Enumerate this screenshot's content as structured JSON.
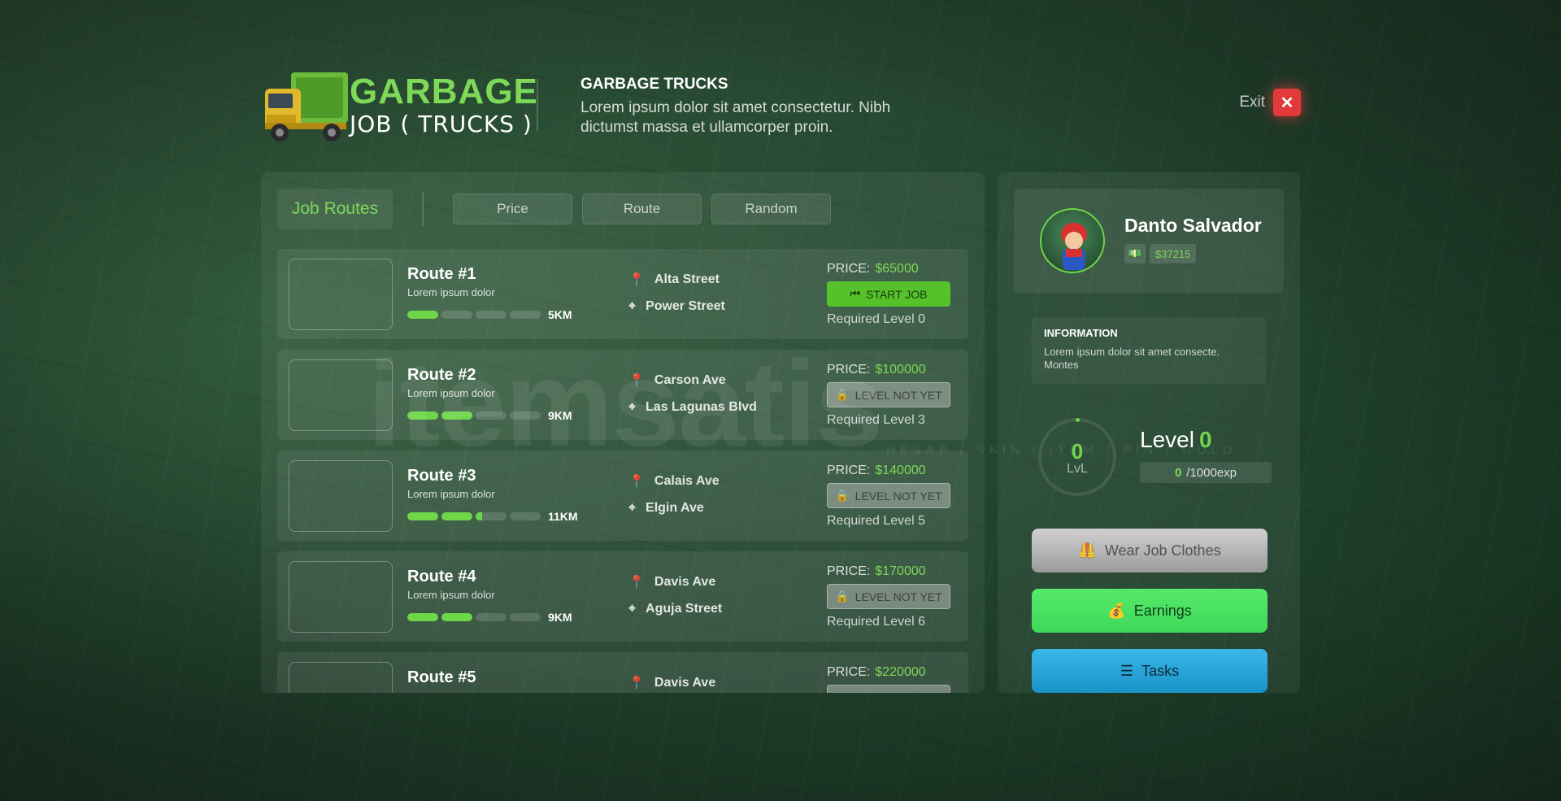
{
  "header": {
    "logo_line1": "GARBAGE",
    "logo_line2": "JOB ( TRUCKS )",
    "info_title": "GARBAGE TRUCKS",
    "info_desc": "Lorem ipsum dolor sit amet consectetur. Nibh dictumst massa et ullamcorper proin.",
    "exit_label": "Exit",
    "exit_icon": "close-icon"
  },
  "tabs": {
    "active": "Job Routes",
    "filters": [
      "Price",
      "Route",
      "Random"
    ]
  },
  "routes": [
    {
      "name": "Route #1",
      "sub": "Lorem ipsum dolor",
      "progress": [
        1,
        0,
        0,
        0
      ],
      "km": "5KM",
      "from": "Alta Street",
      "to": "Power Street",
      "price_label": "PRICE:",
      "price": "$65000",
      "action": "START JOB",
      "locked": false,
      "required": "Required Level 0"
    },
    {
      "name": "Route #2",
      "sub": "Lorem ipsum dolor",
      "progress": [
        1,
        1,
        0,
        0
      ],
      "km": "9KM",
      "from": "Carson Ave",
      "to": "Las Lagunas Blvd",
      "price_label": "PRICE:",
      "price": "$100000",
      "action": "LEVEL NOT YET",
      "locked": true,
      "required": "Required Level 3"
    },
    {
      "name": "Route #3",
      "sub": "Lorem ipsum dolor",
      "progress": [
        1,
        1,
        0.2,
        0
      ],
      "km": "11KM",
      "from": "Calais Ave",
      "to": "Elgin Ave",
      "price_label": "PRICE:",
      "price": "$140000",
      "action": "LEVEL NOT YET",
      "locked": true,
      "required": "Required Level 5"
    },
    {
      "name": "Route #4",
      "sub": "Lorem ipsum dolor",
      "progress": [
        1,
        1,
        0,
        0
      ],
      "km": "9KM",
      "from": "Davis Ave",
      "to": "Aguja Street",
      "price_label": "PRICE:",
      "price": "$170000",
      "action": "LEVEL NOT YET",
      "locked": true,
      "required": "Required Level 6"
    },
    {
      "name": "Route #5",
      "sub": "",
      "progress": [
        0,
        0,
        0,
        0
      ],
      "km": "",
      "from": "Davis Ave",
      "to": "",
      "price_label": "PRICE:",
      "price": "$220000",
      "action": "",
      "locked": true,
      "required": ""
    }
  ],
  "profile": {
    "name": "Danto Salvador",
    "money": "$37215",
    "money_icon": "cash-icon"
  },
  "information": {
    "title": "INFORMATION",
    "desc": "Lorem ipsum dolor sit amet consecte. Montes"
  },
  "level": {
    "value": "0",
    "ring_label": "LvL",
    "title": "Level",
    "exp_current": "0",
    "exp_total": "/1000exp"
  },
  "buttons": {
    "wear": "Wear Job Clothes",
    "earnings": "Earnings",
    "tasks": "Tasks"
  },
  "watermark": {
    "main": "itemsatis",
    "sub": "HESAP / SKIN / ITEM / PIN / GOLD"
  },
  "colors": {
    "accent_green": "#7ed957",
    "exit_red": "#e23a3a",
    "earnings_green": "#3fd95a",
    "tasks_blue": "#1a93c8"
  }
}
